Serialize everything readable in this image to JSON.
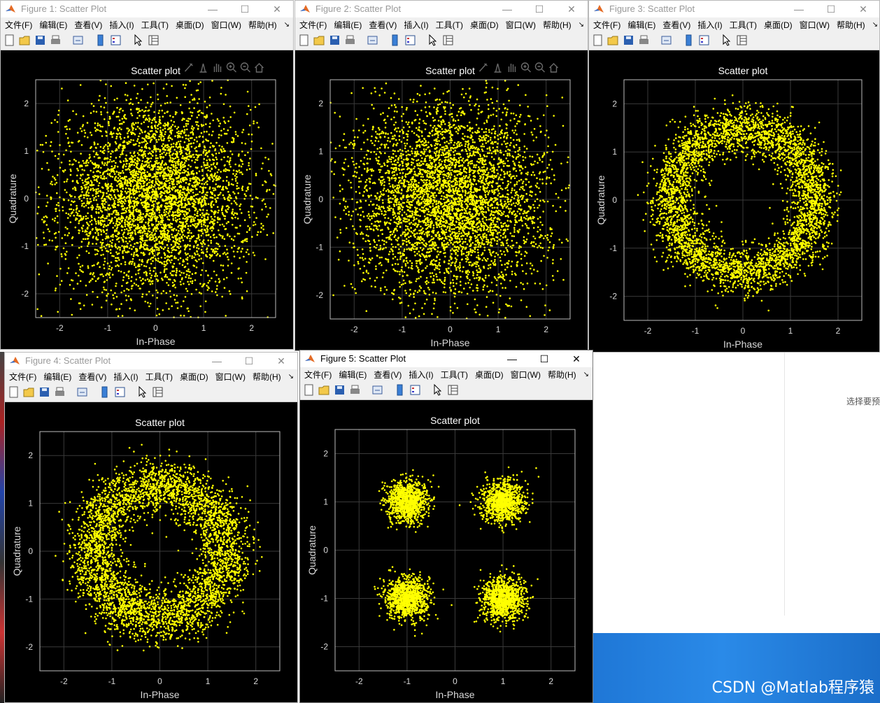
{
  "menu": [
    "文件(F)",
    "编辑(E)",
    "查看(V)",
    "插入(I)",
    "工具(T)",
    "桌面(D)",
    "窗口(W)",
    "帮助(H)"
  ],
  "menu_overflow": "↘",
  "window_buttons": {
    "minimize": "—",
    "maximize": "☐",
    "close": "✕"
  },
  "toolbar_icons": [
    "new-figure-icon",
    "open-file-icon",
    "save-icon",
    "print-icon",
    "link-icon",
    "colorbar-icon",
    "legend-icon",
    "pointer-icon",
    "property-editor-icon"
  ],
  "axes_toolbar_icons": [
    "brush-icon",
    "data-tips-icon",
    "pan-icon",
    "zoom-in-icon",
    "zoom-out-icon",
    "home-icon"
  ],
  "figures": [
    {
      "title": "Figure 1: Scatter Plot",
      "active": false,
      "plot_title": "Scatter plot",
      "xlabel": "In-Phase",
      "ylabel": "Quadrature"
    },
    {
      "title": "Figure 2: Scatter Plot",
      "active": false,
      "plot_title": "Scatter plot",
      "xlabel": "In-Phase",
      "ylabel": "Quadrature"
    },
    {
      "title": "Figure 3: Scatter Plot",
      "active": false,
      "plot_title": "Scatter plot",
      "xlabel": "In-Phase",
      "ylabel": "Quadrature"
    },
    {
      "title": "Figure 4: Scatter Plot",
      "active": false,
      "plot_title": "Scatter plot",
      "xlabel": "In-Phase",
      "ylabel": "Quadrature"
    },
    {
      "title": "Figure 5: Scatter Plot",
      "active": true,
      "plot_title": "Scatter plot",
      "xlabel": "In-Phase",
      "ylabel": "Quadrature"
    }
  ],
  "background": {
    "text": "选择要预",
    "watermark": "CSDN @Matlab程序猿"
  },
  "colors": {
    "marker": "#ffff00",
    "axes_bg": "#000000",
    "grid": "#3a3a3a",
    "tick_text": "#d9d9d9"
  },
  "chart_data": [
    {
      "type": "scatter",
      "title": "Scatter plot",
      "xlabel": "In-Phase",
      "ylabel": "Quadrature",
      "xlim": [
        -2.5,
        2.5
      ],
      "ylim": [
        -2.5,
        2.5
      ],
      "xticks": [
        -2,
        -1,
        0,
        1,
        2
      ],
      "yticks": [
        -2,
        -1,
        0,
        1,
        2
      ],
      "grid": true,
      "marker_color": "#ffff00",
      "distribution": {
        "shape": "gaussian",
        "center": [
          0,
          0
        ],
        "std": 1.0,
        "count": 4500
      }
    },
    {
      "type": "scatter",
      "title": "Scatter plot",
      "xlabel": "In-Phase",
      "ylabel": "Quadrature",
      "xlim": [
        -2.5,
        2.5
      ],
      "ylim": [
        -2.5,
        2.5
      ],
      "xticks": [
        -2,
        -1,
        0,
        1,
        2
      ],
      "yticks": [
        -2,
        -1,
        0,
        1,
        2
      ],
      "grid": true,
      "marker_color": "#ffff00",
      "distribution": {
        "shape": "gaussian",
        "center": [
          0,
          0
        ],
        "std": 1.0,
        "count": 4500
      }
    },
    {
      "type": "scatter",
      "title": "Scatter plot",
      "xlabel": "In-Phase",
      "ylabel": "Quadrature",
      "xlim": [
        -2.5,
        2.5
      ],
      "ylim": [
        -2.5,
        2.5
      ],
      "xticks": [
        -2,
        -1,
        0,
        1,
        2
      ],
      "yticks": [
        -2,
        -1,
        0,
        1,
        2
      ],
      "grid": true,
      "marker_color": "#ffff00",
      "distribution": {
        "shape": "ring",
        "center": [
          0,
          0
        ],
        "radius": 1.5,
        "std": 0.25,
        "count": 4000
      }
    },
    {
      "type": "scatter",
      "title": "Scatter plot",
      "xlabel": "In-Phase",
      "ylabel": "Quadrature",
      "xlim": [
        -2.5,
        2.5
      ],
      "ylim": [
        -2.5,
        2.5
      ],
      "xticks": [
        -2,
        -1,
        0,
        1,
        2
      ],
      "yticks": [
        -2,
        -1,
        0,
        1,
        2
      ],
      "grid": true,
      "marker_color": "#ffff00",
      "distribution": {
        "shape": "ring",
        "center": [
          0,
          0
        ],
        "radius": 1.4,
        "std": 0.28,
        "count": 4000
      }
    },
    {
      "type": "scatter",
      "title": "Scatter plot",
      "xlabel": "In-Phase",
      "ylabel": "Quadrature",
      "xlim": [
        -2.5,
        2.5
      ],
      "ylim": [
        -2.5,
        2.5
      ],
      "xticks": [
        -2,
        -1,
        0,
        1,
        2
      ],
      "yticks": [
        -2,
        -1,
        0,
        1,
        2
      ],
      "grid": true,
      "marker_color": "#ffff00",
      "distribution": {
        "shape": "clusters",
        "centers": [
          [
            -1,
            1
          ],
          [
            1,
            1
          ],
          [
            -1,
            -1
          ],
          [
            1,
            -1
          ]
        ],
        "std": 0.22,
        "count": 4000
      }
    }
  ]
}
